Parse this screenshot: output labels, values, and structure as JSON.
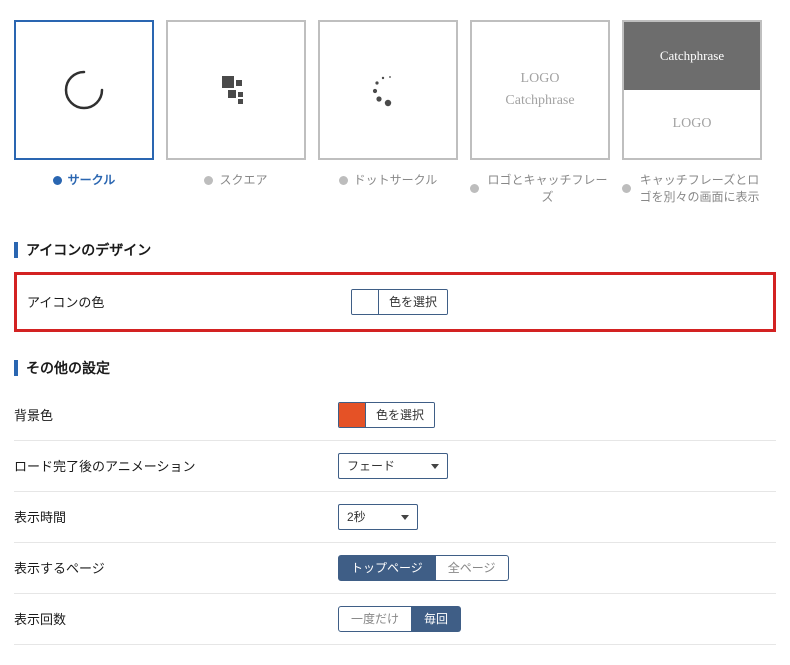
{
  "styles": [
    {
      "key": "circle",
      "label": "サークル",
      "selected": true
    },
    {
      "key": "square",
      "label": "スクエア",
      "selected": false
    },
    {
      "key": "dotcircle",
      "label": "ドットサークル",
      "selected": false
    },
    {
      "key": "logo1",
      "label": "ロゴとキャッチフレーズ",
      "selected": false
    },
    {
      "key": "logo2",
      "label": "キャッチフレーズとロゴを別々の画面に表示",
      "selected": false
    }
  ],
  "preview": {
    "logo": "LOGO",
    "catchphrase": "Catchphrase"
  },
  "sections": {
    "icon_design": "アイコンのデザイン",
    "other": "その他の設定"
  },
  "icon_color": {
    "label": "アイコンの色",
    "button": "色を選択",
    "value": "#ffffff"
  },
  "bg_color": {
    "label": "背景色",
    "button": "色を選択",
    "value": "#e55226"
  },
  "animation": {
    "label": "ロード完了後のアニメーション",
    "value": "フェード"
  },
  "duration": {
    "label": "表示時間",
    "value": "2秒"
  },
  "pages": {
    "label": "表示するページ",
    "options": [
      "トップページ",
      "全ページ"
    ],
    "active": 0
  },
  "count": {
    "label": "表示回数",
    "options": [
      "一度だけ",
      "毎回"
    ],
    "active": 1
  }
}
